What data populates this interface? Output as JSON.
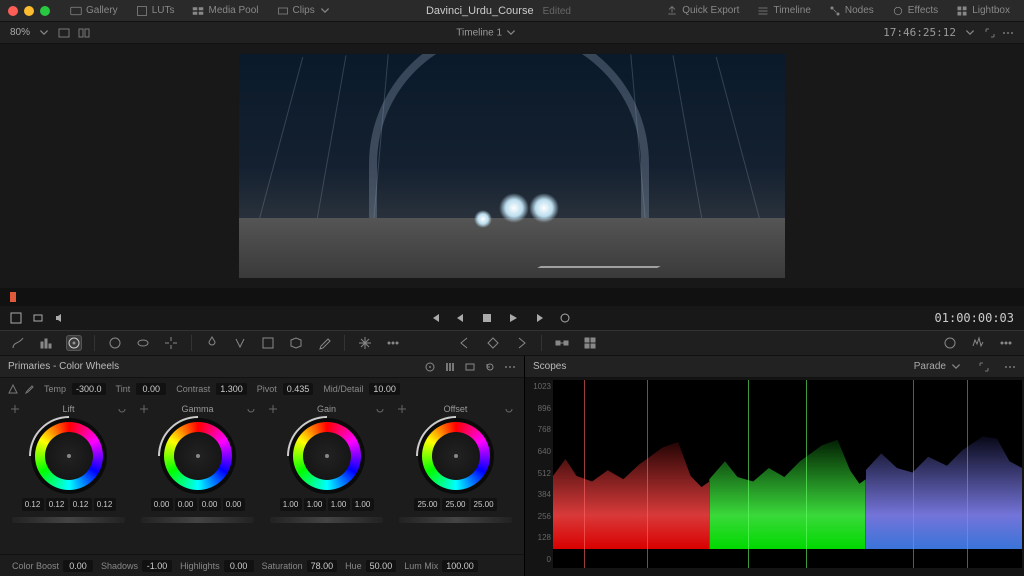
{
  "top": {
    "gallery": "Gallery",
    "luts": "LUTs",
    "mediapool": "Media Pool",
    "clips": "Clips",
    "title": "Davinci_Urdu_Course",
    "status": "Edited",
    "quickexport": "Quick Export",
    "timeline": "Timeline",
    "nodes": "Nodes",
    "effects": "Effects",
    "lightbox": "Lightbox"
  },
  "sub": {
    "zoom": "80%",
    "timeline_name": "Timeline 1",
    "timecode_top": "17:46:25:12"
  },
  "transport": {
    "timecode": "01:00:00:03"
  },
  "primaries": {
    "title": "Primaries - Color Wheels",
    "temp_label": "Temp",
    "temp_val": "-300.0",
    "tint_label": "Tint",
    "tint_val": "0.00",
    "contrast_label": "Contrast",
    "contrast_val": "1.300",
    "pivot_label": "Pivot",
    "pivot_val": "0.435",
    "mid_label": "Mid/Detail",
    "mid_val": "10.00",
    "wheels": [
      {
        "name": "Lift",
        "vals": [
          "0.12",
          "0.12",
          "0.12",
          "0.12"
        ]
      },
      {
        "name": "Gamma",
        "vals": [
          "0.00",
          "0.00",
          "0.00",
          "0.00"
        ]
      },
      {
        "name": "Gain",
        "vals": [
          "1.00",
          "1.00",
          "1.00",
          "1.00"
        ]
      },
      {
        "name": "Offset",
        "vals": [
          "25.00",
          "25.00",
          "25.00"
        ]
      }
    ],
    "bottom": {
      "colboost_l": "Color Boost",
      "colboost_v": "0.00",
      "shad_l": "Shadows",
      "shad_v": "-1.00",
      "hi_l": "Highlights",
      "hi_v": "0.00",
      "sat_l": "Saturation",
      "sat_v": "78.00",
      "hue_l": "Hue",
      "hue_v": "50.00",
      "lum_l": "Lum Mix",
      "lum_v": "100.00"
    }
  },
  "scopes": {
    "title": "Scopes",
    "mode": "Parade",
    "ticks": [
      "1023",
      "896",
      "768",
      "640",
      "512",
      "384",
      "256",
      "128",
      "0"
    ]
  }
}
